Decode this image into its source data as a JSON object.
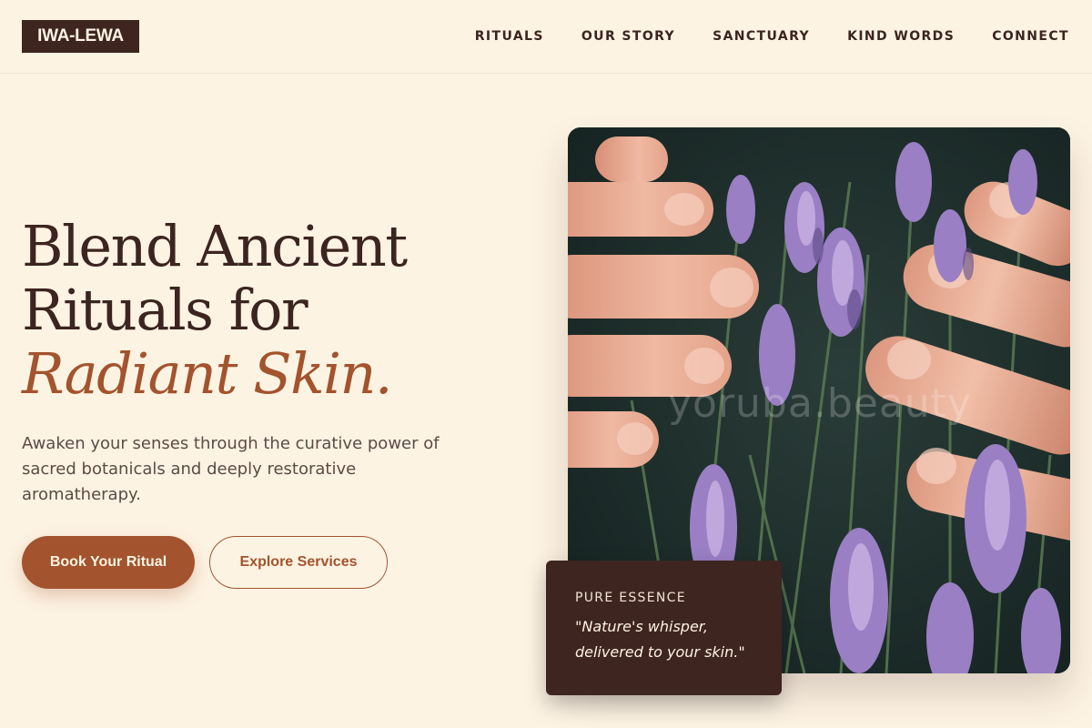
{
  "brand": {
    "logo": "IWA-LEWA"
  },
  "nav": {
    "items": [
      {
        "label": "RITUALS"
      },
      {
        "label": "OUR STORY"
      },
      {
        "label": "SANCTUARY"
      },
      {
        "label": "KIND WORDS"
      },
      {
        "label": "CONNECT"
      }
    ]
  },
  "hero": {
    "title_line1": "Blend Ancient",
    "title_line2": "Rituals for",
    "title_accent": "Radiant Skin.",
    "subtitle": "Awaken your senses through the curative power of sacred botanicals and deeply restorative aromatherapy.",
    "primary_cta": "Book Your Ritual",
    "secondary_cta": "Explore Services"
  },
  "image": {
    "subject": "lavender-in-hands",
    "watermark": "yoruba.beauty"
  },
  "quote_card": {
    "label": "PURE ESSENCE",
    "text": "\"Nature's whisper, delivered to your skin.\""
  },
  "colors": {
    "background": "#fdf3e3",
    "dark_brown": "#3e2520",
    "accent": "#a3532d",
    "text_muted": "#5c4a45"
  }
}
